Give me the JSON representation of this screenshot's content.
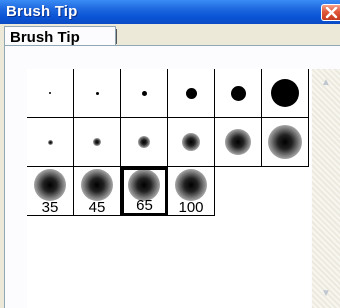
{
  "window": {
    "title": "Brush Tip",
    "close_icon": "close-icon"
  },
  "tabs": [
    {
      "label": "Brush Tip"
    }
  ],
  "brush_grid": {
    "rows": [
      [
        {
          "type": "hard",
          "size": 1
        },
        {
          "type": "hard",
          "size": 2
        },
        {
          "type": "hard",
          "size": 3
        },
        {
          "type": "hard",
          "size": 5
        },
        {
          "type": "hard",
          "size": 9
        },
        {
          "type": "hard",
          "size": 13
        }
      ],
      [
        {
          "type": "soft",
          "size": 2
        },
        {
          "type": "soft",
          "size": 3
        },
        {
          "type": "soft",
          "size": 5
        },
        {
          "type": "soft",
          "size": 9
        },
        {
          "type": "soft",
          "size": 13
        },
        {
          "type": "soft",
          "size": 19
        }
      ],
      [
        {
          "type": "soft",
          "size": 35,
          "label": "35"
        },
        {
          "type": "soft",
          "size": 45,
          "label": "45"
        },
        {
          "type": "soft",
          "size": 65,
          "label": "65",
          "selected": true
        },
        {
          "type": "soft",
          "size": 100,
          "label": "100"
        }
      ]
    ]
  },
  "scrollbar": {
    "up_icon": "scroll-up-icon",
    "down_icon": "scroll-down-icon"
  }
}
